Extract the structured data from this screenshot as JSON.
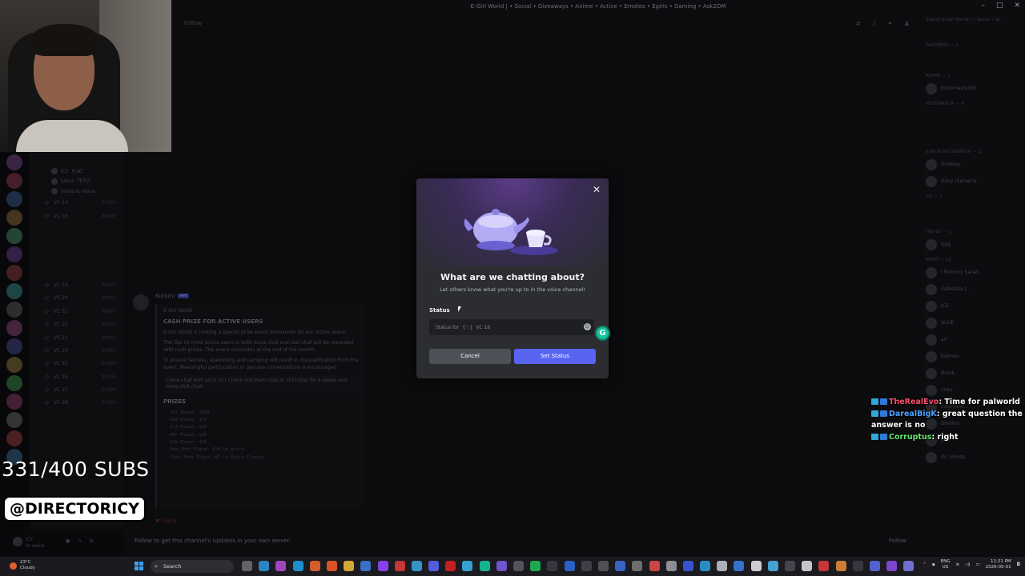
{
  "window": {
    "title": "E-Girl World | • Social • Giveaways • Anime • Active • Emotes • Egirls • Gaming • Ask2DM",
    "controls": [
      "–",
      "□",
      "✕"
    ]
  },
  "chat_header": {
    "follow": "Follow"
  },
  "channels": {
    "items": [
      {
        "name": "ICY",
        "extra": "FLAT"
      },
      {
        "name": "Lotus",
        "extra": "TETO"
      },
      {
        "name": "Invite to Voice",
        "extra": ""
      },
      {
        "name": "VC 14",
        "extra": "00/99"
      },
      {
        "name": "VC 16",
        "extra": "00/99"
      },
      {
        "name": "VC 19",
        "extra": "00/99"
      },
      {
        "name": "VC 20",
        "extra": "00/99"
      },
      {
        "name": "VC 21",
        "extra": "00/99"
      },
      {
        "name": "VC 22",
        "extra": "00/99"
      },
      {
        "name": "VC 23",
        "extra": "00/99"
      },
      {
        "name": "VC 24",
        "extra": "00/99"
      },
      {
        "name": "VC 25",
        "extra": "00/99"
      },
      {
        "name": "VC 26",
        "extra": "00/99"
      },
      {
        "name": "VC 27",
        "extra": "00/99"
      },
      {
        "name": "VC 28",
        "extra": "00/99"
      }
    ]
  },
  "user_panel": {
    "name": "ICY",
    "status": "In voice"
  },
  "message": {
    "author": "Kuromi",
    "app_tag": "APP",
    "embed_title": "E-Girl World",
    "heading": "CASH PRIZE FOR ACTIVE USERS",
    "line1": "E-Girl World is hosting a special prize event exclusively for our active users!",
    "line2": "The Top 20 most active users in both voice chat and text chat will be rewarded with cash prizes. The event concludes at the end of the month.",
    "line3": "To ensure fairness, spamming and camping will result in disqualification from the event. Meaningful participation in genuine conversations is encouraged.",
    "line4": "Come chat with us in VC! Check out main-chat or chill-chat for a sweet and more chill chat!",
    "prizes_heading": "PRIZES",
    "prizes": [
      "1st Place: $150",
      "2nd Place: $75",
      "3rd Place: $50",
      "4th Place: $35",
      "5th Place: $25",
      "6th-10th Place: $10 in Nitro",
      "11th-20th Place: $5 in Nitro Classic"
    ],
    "reaction": "32804"
  },
  "follow_bar": {
    "text": "Follow to get this channel's updates in your own server.",
    "button": "Follow"
  },
  "members": {
    "search": "Search E-Girl World | • Social • Gi...",
    "categories": [
      "Partners — 1",
      "Admin — 1",
      "Moderator — 4",
      "Junior Moderator — 2",
      "VIP — 1",
      "Highly — 1",
      "Most — 12"
    ],
    "names": [
      "boobmaster69",
      "Drewley",
      "Davy (Server's...",
      "Qyg",
      "I Mommy Sarah",
      "3aMe4ter1...",
      "ICE",
      "ALLIE",
      "ari",
      "batman",
      "Brock",
      "chev",
      "cute funn...",
      "Danilorr",
      "Dez",
      "Dr. Shinzu"
    ]
  },
  "webcam_overlay": {
    "sub_count": "331/400 SUBS",
    "handle": "@DIRECTORICY"
  },
  "stream_chat": [
    {
      "user": "TheRealEvo",
      "user_color": "#ff4d6d",
      "message": ": Time for palworld"
    },
    {
      "user": "DarealBigK",
      "user_color": "#4aa3ff",
      "message": ": great question the answer is no"
    },
    {
      "user": "Corruptus",
      "user_color": "#62e86a",
      "message": ": right"
    }
  ],
  "modal": {
    "title": "What are we chatting about?",
    "subtitle": "Let others know what you're up to in the voice channel!",
    "status_label": "Status",
    "input_placeholder": "Status for",
    "channel_name": "VC 16",
    "cancel": "Cancel",
    "submit": "Set Status",
    "accent": "#5865f2"
  },
  "taskbar": {
    "weather_temp": "23°C",
    "weather_desc": "Cloudy",
    "search_label": "Search",
    "lang1": "ENG",
    "lang2": "US",
    "time": "11:21 PM",
    "date": "2026-05-01"
  }
}
